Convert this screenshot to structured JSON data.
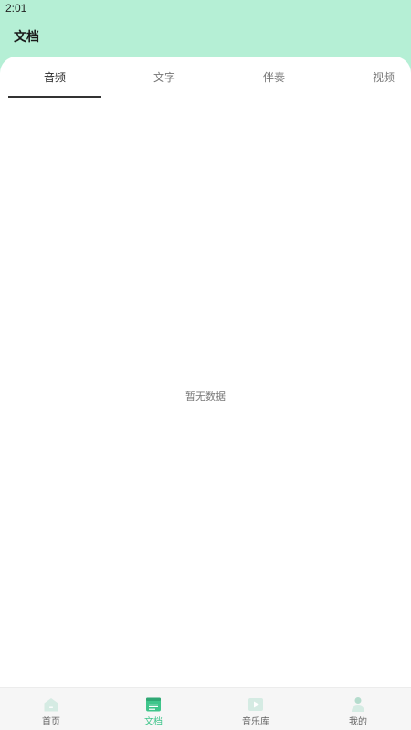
{
  "status_bar": {
    "time": "2:01"
  },
  "header": {
    "title": "文档"
  },
  "tabs": [
    {
      "label": "音频",
      "active": true
    },
    {
      "label": "文字",
      "active": false
    },
    {
      "label": "伴奏",
      "active": false
    },
    {
      "label": "视频",
      "active": false
    }
  ],
  "empty_state": {
    "text": "暂无数据"
  },
  "bottom_nav": [
    {
      "label": "首页",
      "icon": "home-icon",
      "active": false
    },
    {
      "label": "文档",
      "icon": "document-icon",
      "active": true
    },
    {
      "label": "音乐库",
      "icon": "music-library-icon",
      "active": false
    },
    {
      "label": "我的",
      "icon": "profile-icon",
      "active": false
    }
  ],
  "colors": {
    "header_background": "#b5efd5",
    "accent": "#3fc58b",
    "inactive_icon": "#d5ebe3"
  }
}
